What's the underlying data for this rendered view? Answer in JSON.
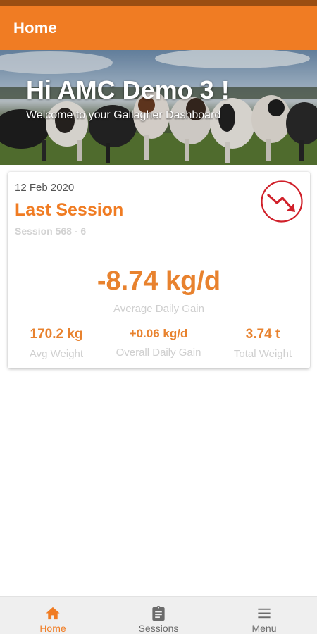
{
  "app_bar": {
    "title": "Home"
  },
  "hero": {
    "greeting": "Hi AMC Demo 3 !",
    "subtitle": "Welcome to your Gallagher Dashboard"
  },
  "last_session": {
    "date": "12 Feb 2020",
    "title": "Last Session",
    "session_id": "Session 568 - 6",
    "trend_icon": "trending-down-icon",
    "average_daily_gain": {
      "value": "-8.74 kg/d",
      "label": "Average Daily Gain"
    },
    "stats": [
      {
        "value": "170.2 kg",
        "label": "Avg Weight"
      },
      {
        "value": "+0.06 kg/d",
        "label": "Overall Daily Gain"
      },
      {
        "value": "3.74 t",
        "label": "Total Weight"
      }
    ]
  },
  "bottom_nav": {
    "items": [
      {
        "label": "Home",
        "icon": "home-icon",
        "active": true
      },
      {
        "label": "Sessions",
        "icon": "clipboard-icon",
        "active": false
      },
      {
        "label": "Menu",
        "icon": "menu-icon",
        "active": false
      }
    ]
  },
  "colors": {
    "primary": "#f07c23",
    "accent_text": "#e8822e",
    "status_bar": "#9a4e12",
    "trend_down": "#d0202a",
    "muted_text": "#cfcfcf",
    "nav_background": "#efefef"
  }
}
